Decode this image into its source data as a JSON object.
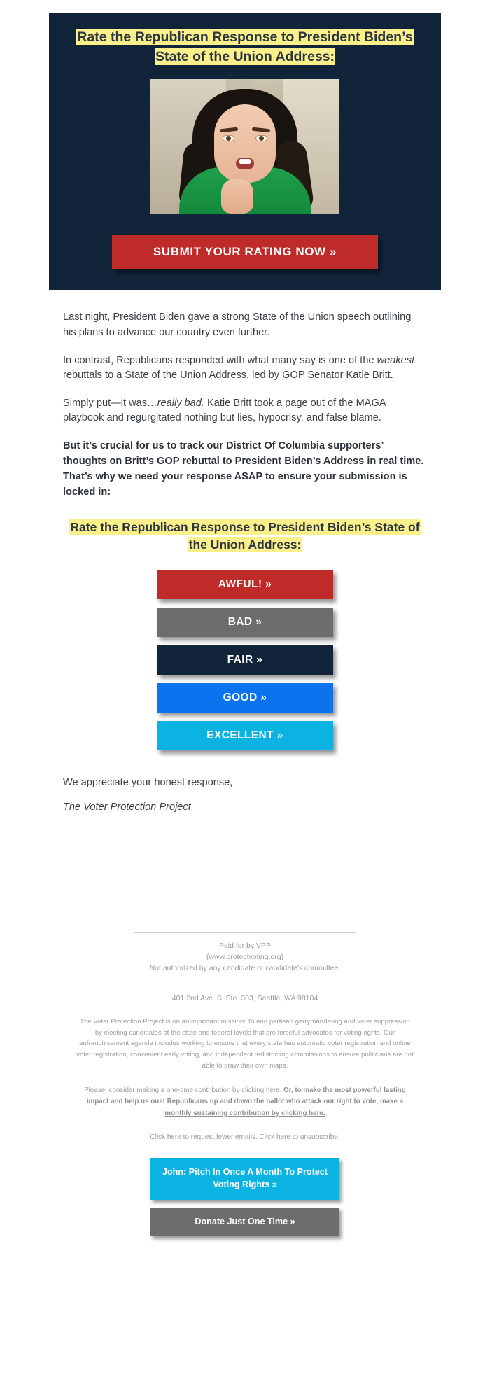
{
  "hero": {
    "headline": "Rate the Republican Response to President Biden’s State of the Union Address:",
    "photo_alt": "katie-britt-video-still",
    "submit_label": "SUBMIT YOUR RATING NOW »",
    "background_color": "#12243a",
    "highlight_color": "#fbf08a",
    "submit_color": "#bf2b29"
  },
  "body": {
    "p1": "Last night, President Biden gave a strong State of the Union speech outlining his plans to advance our country even further.",
    "p2_a": "In contrast, Republicans responded with what many say is one of the ",
    "p2_em": "weakest",
    "p2_b": " rebuttals to a State of the Union Address, led by GOP Senator Katie Britt.",
    "p3_a": "Simply put—it was…",
    "p3_em": "really bad.",
    "p3_b": " Katie Britt took a page out of the MAGA playbook and regurgitated nothing but lies, hypocrisy, and false blame.",
    "p4": "But it’s crucial for us to track our District Of Columbia supporters’ thoughts on Britt’s GOP rebuttal to President Biden’s Address in real time. That’s why we need your response ASAP to ensure your submission is locked in:"
  },
  "rate_section": {
    "headline": "Rate the Republican Response to President Biden’s State of the Union Address:",
    "buttons": [
      {
        "label": "AWFUL! »",
        "color": "#bf2b29"
      },
      {
        "label": "BAD »",
        "color": "#6d6d6d"
      },
      {
        "label": "FAIR »",
        "color": "#12243a"
      },
      {
        "label": "GOOD »",
        "color": "#0a73ed"
      },
      {
        "label": "EXCELLENT »",
        "color": "#0bb3e3"
      }
    ]
  },
  "signoff": {
    "thanks": "We appreciate your honest response,",
    "signature": "The Voter Protection Project"
  },
  "footer": {
    "paid_line1": "Paid for by VPP",
    "paid_link": "(www.protectvoting.org)",
    "paid_line3": "Not authorized by any candidate or candidate's committee.",
    "address": "401 2nd Ave. S, Ste. 303, Seattle, WA 98104",
    "mission": "The Voter Protection Project is on an important mission: To end partisan gerrymandering and voter suppression by electing candidates at the state and federal levels that are forceful advocates for voting rights. Our enfranchisement agenda includes working to ensure that every state has automatic voter registration and online voter registration, convenient early voting, and independent redistricting commissions to ensure politicians are not able to draw their own maps.",
    "ask_a": "Please, consider making a ",
    "ask_link1": "one-time contribution by clicking here",
    "ask_b": ". ",
    "ask_bold": "Or, to make the most powerful lasting impact and help us oust Republicans up and down the ballot who attack our right to vote, make a ",
    "ask_link2": "monthly sustaining contribution by clicking here.",
    "unsub_link": "Click here",
    "unsub_rest": " to request fewer emails. Click here to unsubscribe.",
    "buttons": [
      {
        "label": "John: Pitch In Once A Month To Protect Voting Rights »",
        "color": "#0bb3e3"
      },
      {
        "label": "Donate Just One Time »",
        "color": "#6d6d6d"
      }
    ]
  }
}
